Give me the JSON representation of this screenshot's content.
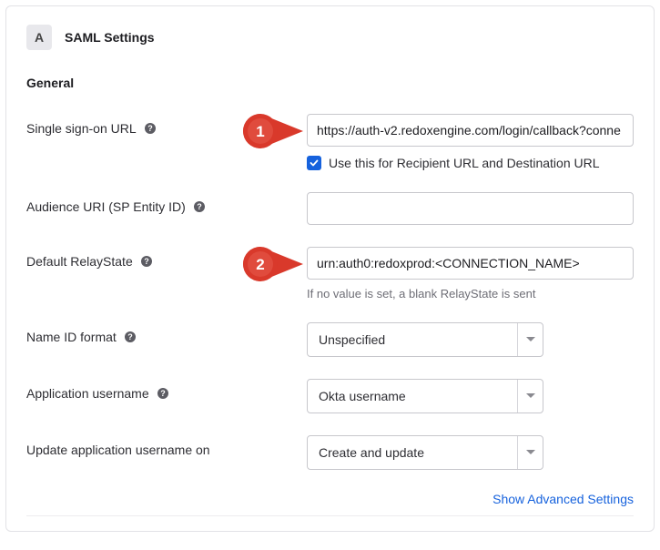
{
  "header": {
    "step_letter": "A",
    "title": "SAML Settings"
  },
  "general": {
    "heading": "General",
    "sso_url": {
      "label": "Single sign-on URL",
      "value": "https://auth-v2.redoxengine.com/login/callback?conne",
      "checkbox_label": "Use this for Recipient URL and Destination URL"
    },
    "audience_uri": {
      "label": "Audience URI (SP Entity ID)",
      "value": ""
    },
    "relay_state": {
      "label": "Default RelayState",
      "value": "urn:auth0:redoxprod:<CONNECTION_NAME>",
      "hint": "If no value is set, a blank RelayState is sent"
    },
    "nameid_format": {
      "label": "Name ID format",
      "value": "Unspecified"
    },
    "app_username": {
      "label": "Application username",
      "value": "Okta username"
    },
    "update_on": {
      "label": "Update application username on",
      "value": "Create and update"
    }
  },
  "advanced_link": "Show Advanced Settings",
  "callouts": {
    "one": "1",
    "two": "2"
  }
}
